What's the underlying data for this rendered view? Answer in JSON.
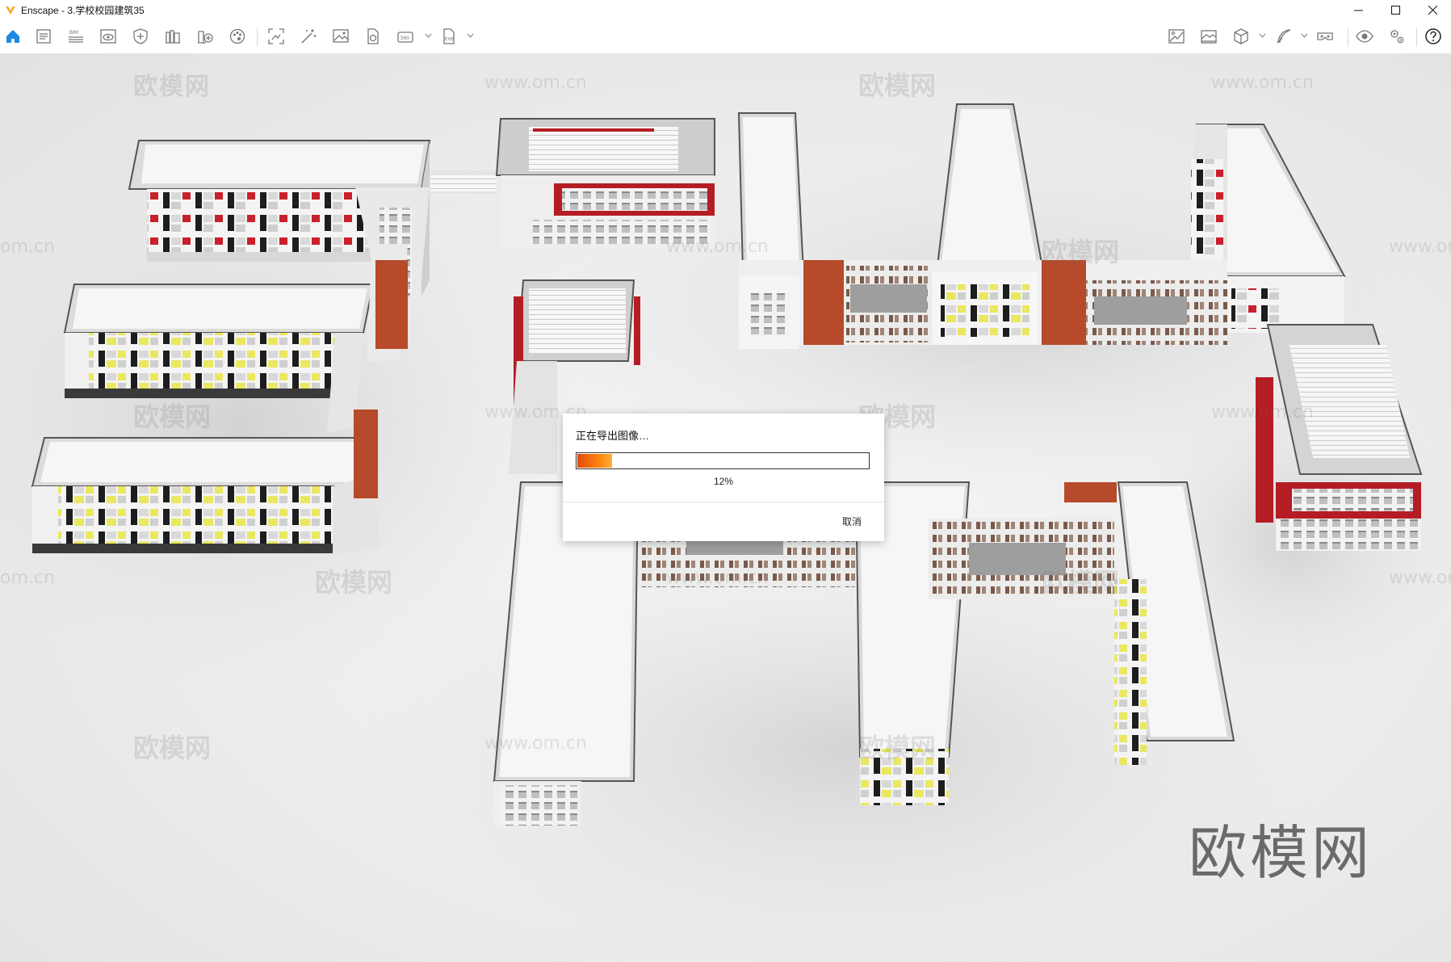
{
  "window": {
    "app_name": "Enscape - 3.学校校园建筑35",
    "accent_color": "#f6a623"
  },
  "toolbar": {
    "left_icons": [
      "home-icon",
      "document-icon",
      "bim-icon",
      "eye-view-icon",
      "shield-asset-icon",
      "library-icon",
      "add-library-icon",
      "material-palette-icon",
      "screenshot-icon",
      "magic-wand-icon",
      "image-export-icon",
      "document-export-icon",
      "panorama-360-icon",
      "exe-export-icon"
    ],
    "right_icons": [
      "atmosphere-icon",
      "landscape-icon",
      "cube-view-icon",
      "feather-brush-icon",
      "vr-headset-icon",
      "eye-visual-icon",
      "settings-gear-icon",
      "help-icon"
    ]
  },
  "dialog": {
    "title": "正在导出图像…",
    "progress": 0.12,
    "progress_label": "12%",
    "cancel_label": "取消",
    "progress_color_start": "#e34b0a",
    "progress_color_end": "#ffb040"
  },
  "watermark": {
    "brand": "欧模网",
    "url": "www.om.cn",
    "url_fragment": "om.cn"
  }
}
